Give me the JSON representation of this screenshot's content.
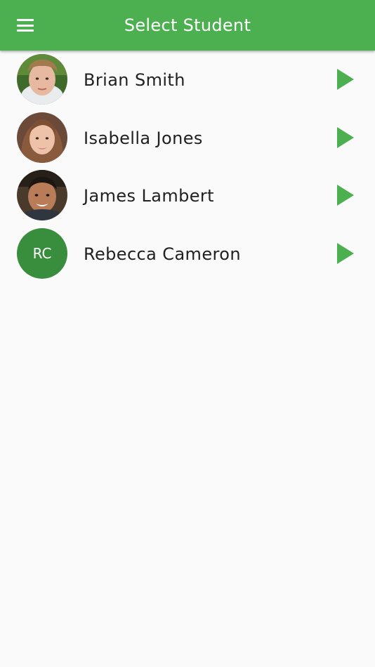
{
  "app_bar": {
    "title": "Select Student",
    "menu_icon": "menu-icon",
    "background_color": "#4caf50"
  },
  "students": [
    {
      "name": "Brian Smith",
      "avatar": "photo",
      "action_icon": "play-icon"
    },
    {
      "name": "Isabella Jones",
      "avatar": "photo",
      "action_icon": "play-icon"
    },
    {
      "name": "James Lambert",
      "avatar": "photo",
      "action_icon": "play-icon"
    },
    {
      "name": "Rebecca Cameron",
      "avatar": "initials",
      "initials": "RC",
      "action_icon": "play-icon"
    }
  ],
  "colors": {
    "accent": "#4caf50",
    "initials_avatar": "#388e3c",
    "background": "#fafafa"
  }
}
